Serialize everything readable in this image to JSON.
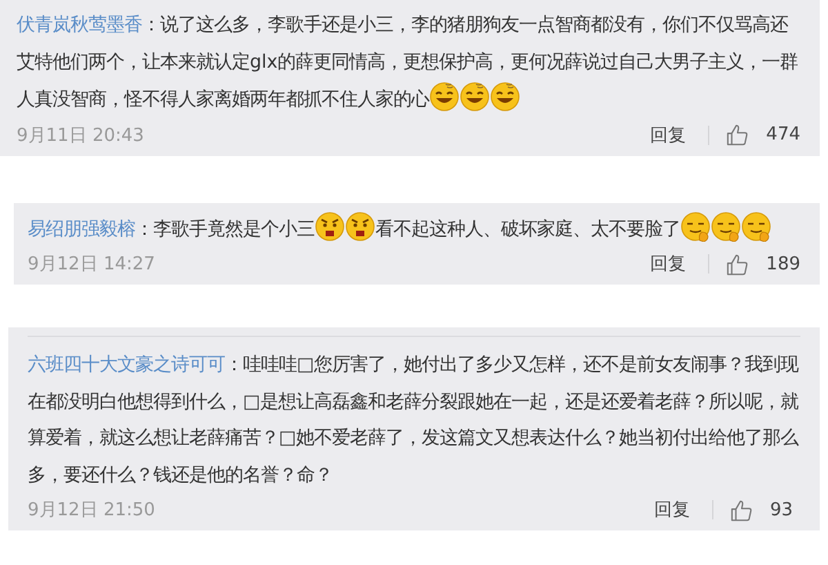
{
  "comments": [
    {
      "user": "伏青岚秋莺墨香",
      "content": [
        {
          "kind": "text",
          "text": "：说了这么多，李歌手还是小三，李的猪朋狗友一点智商都没有，你们不仅骂高还艾特他们两个，让本来就认定glx的薛更同情高，更想保护高，更何况薛说过自己大男子主义，一群人真没智商，怪不得人家离婚两年都抓不住人家的心"
        },
        {
          "kind": "laugh"
        },
        {
          "kind": "laugh"
        },
        {
          "kind": "laugh"
        }
      ],
      "time": "9月11日 20:43",
      "reply": "回复",
      "likes": "474"
    },
    {
      "user": "易绍朋强毅榕",
      "content": [
        {
          "kind": "text",
          "text": "：李歌手竟然是个小三"
        },
        {
          "kind": "angry"
        },
        {
          "kind": "angry"
        },
        {
          "kind": "text",
          "text": "看不起这种人、破坏家庭、太不要脸了"
        },
        {
          "kind": "smirk"
        },
        {
          "kind": "smirk"
        },
        {
          "kind": "smirk"
        }
      ],
      "time": "9月12日 14:27",
      "reply": "回复",
      "likes": "189"
    },
    {
      "user": "六班四十大文豪之诗可可",
      "content": [
        {
          "kind": "text",
          "text": "：哇哇哇□您厉害了，她付出了多少又怎样，还不是前女友闹事？我到现在都没明白他想得到什么，□是想让高磊鑫和老薛分裂跟她在一起，还是还爱着老薛？所以呢，就算爱着，就这么想让老薛痛苦？□她不爱老薛了，发这篇文又想表达什么？她当初付出给他了那么多，要还什么？钱还是他的名誉？命？"
        }
      ],
      "time": "9月12日 21:50",
      "reply": "回复",
      "likes": "93"
    }
  ]
}
